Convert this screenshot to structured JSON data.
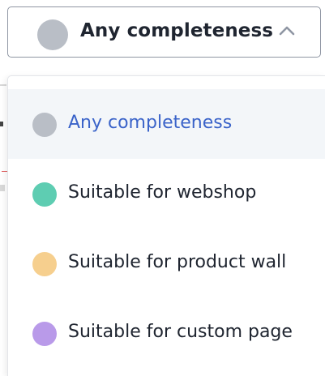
{
  "select": {
    "selected_label": "Any completeness",
    "selected_color": "#b9bec6",
    "expanded": true,
    "chevron_icon": "chevron-up-icon"
  },
  "menu": {
    "options": [
      {
        "label": "Any completeness",
        "color": "#b9bec6",
        "selected": true
      },
      {
        "label": "Suitable for webshop",
        "color": "#5ecdb2",
        "selected": false
      },
      {
        "label": "Suitable for product wall",
        "color": "#f6cf8e",
        "selected": false
      },
      {
        "label": "Suitable for custom page",
        "color": "#b99ae9",
        "selected": false
      }
    ]
  },
  "colors": {
    "selected_text": "#3a63c9",
    "text": "#1f2530",
    "border": "#8f96a3",
    "selected_background": "#f3f6f9"
  }
}
